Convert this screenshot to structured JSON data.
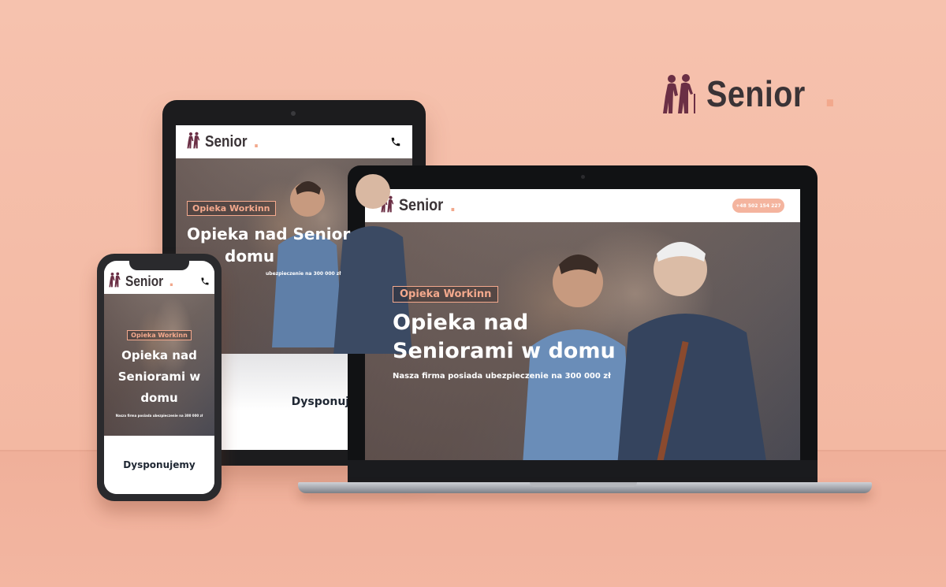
{
  "brand": {
    "name": "Senior",
    "dot": "."
  },
  "site": {
    "logo_text": "Senior",
    "logo_dot": ".",
    "badge": "Opieka Workinn",
    "title_line1": "Opieka nad",
    "title_line2": "Seniorami w domu",
    "subtitle": "Nasza firma posiada ubezpieczenie na 300 000 zł",
    "phone_number": "+48 502 154 227",
    "section_heading": "Dysponujemy"
  },
  "tablet": {
    "title_line1": "Opieka nad Senior",
    "title_line2": "domu",
    "subtitle": "ubezpieczenie na 300 000 zł"
  },
  "phone": {
    "title_line1": "Opieka nad",
    "title_line2": "Seniorami w",
    "title_line3": "domu"
  },
  "colors": {
    "background": "#f4b9a4",
    "accent": "#f4a98d",
    "logo_text": "#3a3336",
    "logo_icon": "#6b2f45"
  },
  "icons": [
    "elderly-couple-icon",
    "phone-icon"
  ]
}
